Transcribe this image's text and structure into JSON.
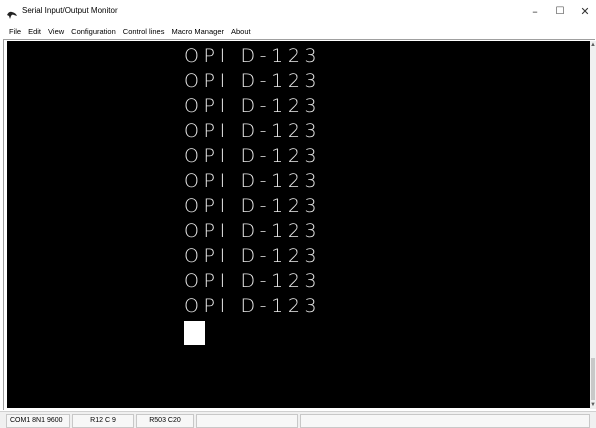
{
  "window": {
    "title": "Serial Input/Output Monitor",
    "min_glyph": "–",
    "max_glyph": "☐",
    "close_glyph": "✕"
  },
  "menu": {
    "items": [
      "File",
      "Edit",
      "View",
      "Configuration",
      "Control lines",
      "Macro Manager",
      "About"
    ]
  },
  "terminal": {
    "lines": [
      "OPI D-123",
      "OPI D-123",
      "OPI D-123",
      "OPI D-123",
      "OPI D-123",
      "OPI D-123",
      "OPI D-123",
      "OPI D-123",
      "OPI D-123",
      "OPI D-123",
      "OPI D-123"
    ],
    "background": "#000000",
    "foreground": "#e9e9e9"
  },
  "statusbar": {
    "port": "COM1 8N1 9600",
    "cursor_pos": "R12 C 9",
    "buffer": "R503 C20"
  },
  "icons": {
    "app": "serial-app-icon",
    "scroll_up": "scroll-up-arrow-icon",
    "scroll_down": "scroll-down-arrow-icon"
  }
}
